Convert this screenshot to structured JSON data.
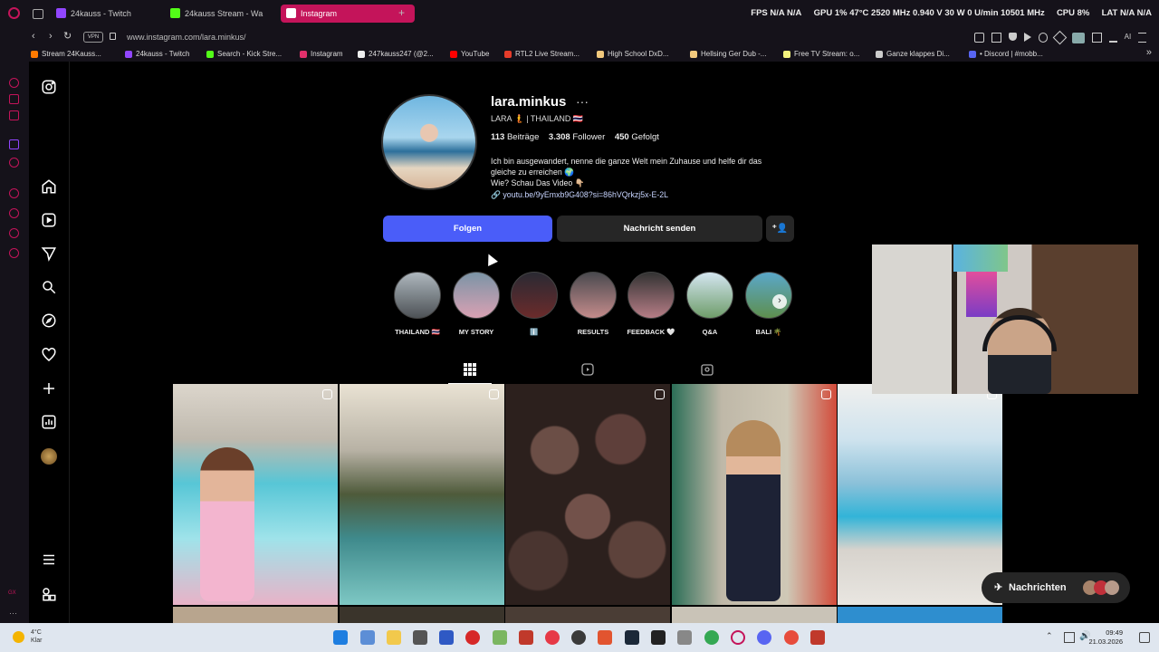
{
  "browser": {
    "tabs": [
      {
        "label": "24kauss - Twitch",
        "color": "#9146ff"
      },
      {
        "label": "24kauss Stream - Wa",
        "color": "#53fc18"
      },
      {
        "label": "Instagram",
        "color": "#e1306c"
      }
    ],
    "url": "www.instagram.com/lara.minkus/",
    "hud": {
      "fps": "FPS N/A N/A",
      "gpu": "GPU 1% 47°C 2520 MHz 0.940 V 30 W 0 U/min 10501 MHz",
      "cpu": "CPU 8%",
      "lat": "LAT N/A N/A"
    },
    "bookmarks": [
      "Stream 24Kauss...",
      "24kauss - Twitch",
      "Search - Kick Stre...",
      "Instagram",
      "247kauss247 (@2...",
      "YouTube",
      "RTL2 Live Stream...",
      "High School DxD...",
      "Hellsing Ger Dub -...",
      "Free TV Stream: o...",
      "Ganze klappes Di...",
      "• Discord | #mobb..."
    ]
  },
  "profile": {
    "username": "lara.minkus",
    "more": "···",
    "fullname": "LARA 🧜 | THAILAND 🇹🇭",
    "stats": {
      "posts": "113",
      "posts_label": "Beiträge",
      "followers": "3.308",
      "followers_label": "Follower",
      "following": "450",
      "following_label": "Gefolgt"
    },
    "bio_line1": "Ich bin ausgewandert, nenne die ganze Welt mein Zuhause und helfe dir das",
    "bio_line2": "gleiche zu erreichen 🌍",
    "bio_line3": "Wie? Schau Das Video 👇🏼",
    "link": "youtu.be/9yEmxb9G408?si=86hVQrkzj5x-E-2L",
    "follow_label": "Folgen",
    "message_label": "Nachricht senden"
  },
  "highlights": [
    {
      "label": "THAILAND 🇹🇭"
    },
    {
      "label": "MY STORY"
    },
    {
      "label": "ℹ️"
    },
    {
      "label": "RESULTS"
    },
    {
      "label": "FEEDBACK 🤍"
    },
    {
      "label": "Q&A"
    },
    {
      "label": "BALI 🌴"
    }
  ],
  "chat": {
    "label": "Nachrichten"
  },
  "taskbar": {
    "weather_temp": "4°C",
    "weather_desc": "Klar",
    "time": "09:49",
    "date": "21.03.2026"
  }
}
